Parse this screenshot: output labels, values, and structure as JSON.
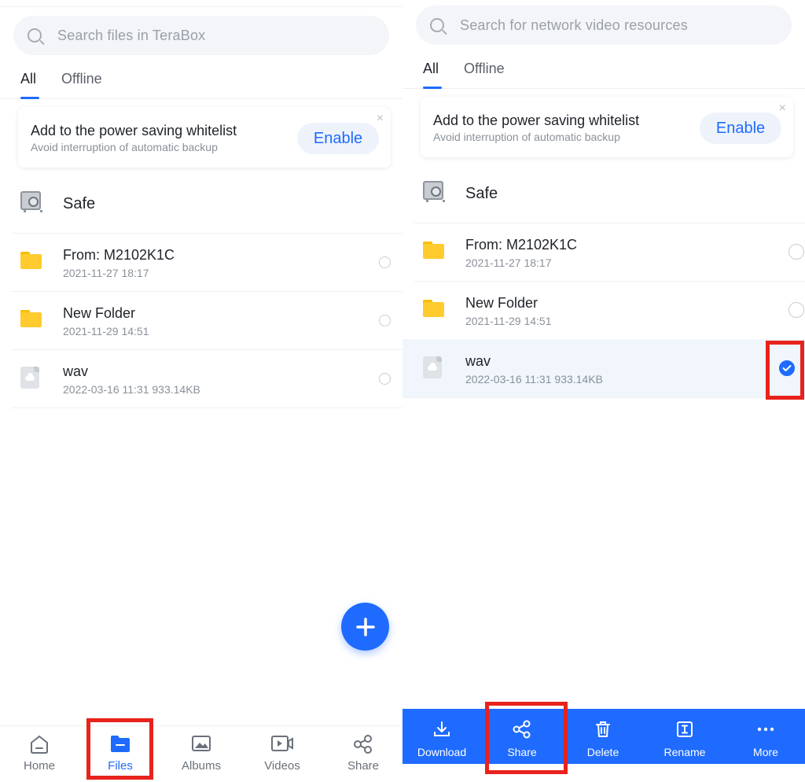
{
  "left": {
    "search": {
      "placeholder": "Search files in TeraBox"
    },
    "tabs": [
      {
        "label": "All",
        "active": true
      },
      {
        "label": "Offline",
        "active": false
      }
    ],
    "banner": {
      "title": "Add to the power saving whitelist",
      "subtitle": "Avoid interruption of automatic backup",
      "button": "Enable",
      "close": "×"
    },
    "safe": {
      "label": "Safe"
    },
    "files": [
      {
        "name": "From: M2102K1C",
        "meta": "2021-11-27  18:17",
        "type": "folder",
        "selected": false
      },
      {
        "name": "New Folder",
        "meta": "2021-11-29  14:51",
        "type": "folder",
        "selected": false
      },
      {
        "name": "wav",
        "meta": "2022-03-16  11:31  933.14KB",
        "type": "file",
        "selected": false
      }
    ],
    "nav": [
      {
        "label": "Home",
        "icon": "home-icon",
        "active": false
      },
      {
        "label": "Files",
        "icon": "files-icon",
        "active": true
      },
      {
        "label": "Albums",
        "icon": "albums-icon",
        "active": false
      },
      {
        "label": "Videos",
        "icon": "videos-icon",
        "active": false
      },
      {
        "label": "Share",
        "icon": "share-icon",
        "active": false
      }
    ]
  },
  "right": {
    "search": {
      "placeholder": "Search for network video resources"
    },
    "tabs": [
      {
        "label": "All",
        "active": true
      },
      {
        "label": "Offline",
        "active": false
      }
    ],
    "banner": {
      "title": "Add to the power saving whitelist",
      "subtitle": "Avoid interruption of automatic backup",
      "button": "Enable",
      "close": "×"
    },
    "safe": {
      "label": "Safe"
    },
    "files": [
      {
        "name": "From: M2102K1C",
        "meta": "2021-11-27  18:17",
        "type": "folder",
        "selected": false
      },
      {
        "name": "New Folder",
        "meta": "2021-11-29  14:51",
        "type": "folder",
        "selected": false
      },
      {
        "name": "wav",
        "meta": "2022-03-16  11:31  933.14KB",
        "type": "file",
        "selected": true
      }
    ],
    "actions": [
      {
        "label": "Download",
        "icon": "download-icon"
      },
      {
        "label": "Share",
        "icon": "share-icon"
      },
      {
        "label": "Delete",
        "icon": "trash-icon"
      },
      {
        "label": "Rename",
        "icon": "rename-icon"
      },
      {
        "label": "More",
        "icon": "more-icon"
      }
    ]
  },
  "colors": {
    "accent": "#1f6bff",
    "highlight": "#e8221c",
    "folder": "#ffcb2e",
    "selected_row": "#f1f6fd"
  }
}
